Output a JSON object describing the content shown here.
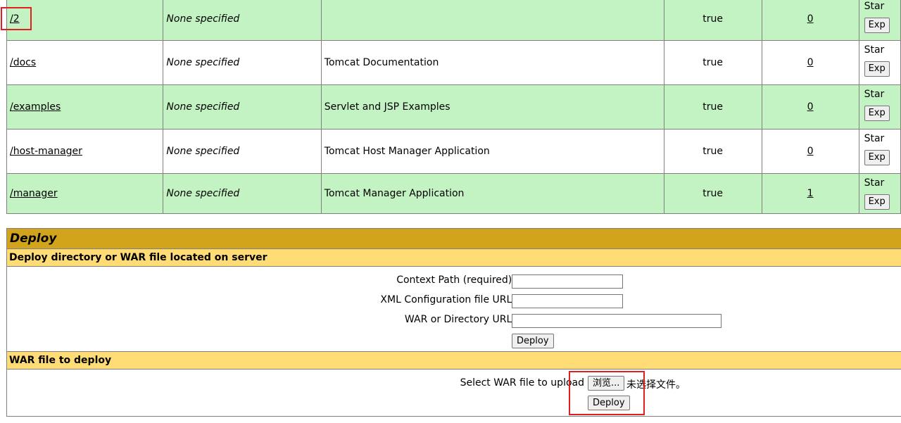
{
  "applications": [
    {
      "path": "/2",
      "version": "None specified",
      "display_name": "",
      "running": "true",
      "sessions": "0",
      "style": "green"
    },
    {
      "path": "/docs",
      "version": "None specified",
      "display_name": "Tomcat Documentation",
      "running": "true",
      "sessions": "0",
      "style": "white"
    },
    {
      "path": "/examples",
      "version": "None specified",
      "display_name": "Servlet and JSP Examples",
      "running": "true",
      "sessions": "0",
      "style": "green"
    },
    {
      "path": "/host-manager",
      "version": "None specified",
      "display_name": "Tomcat Host Manager Application",
      "running": "true",
      "sessions": "0",
      "style": "white"
    },
    {
      "path": "/manager",
      "version": "None specified",
      "display_name": "Tomcat Manager Application",
      "running": "true",
      "sessions": "1",
      "style": "green"
    }
  ],
  "commands": {
    "start": "Star",
    "expire": "Exp"
  },
  "deploy": {
    "title": "Deploy",
    "server_section": {
      "heading": "Deploy directory or WAR file located on server",
      "context_path_label": "Context Path (required):",
      "context_path_value": "",
      "xml_config_label": "XML Configuration file URL:",
      "xml_config_value": "",
      "war_dir_label": "WAR or Directory URL:",
      "war_dir_value": "",
      "deploy_button": "Deploy"
    },
    "war_section": {
      "heading": "WAR file to deploy",
      "select_label": "Select WAR file to upload",
      "browse_button": "浏览...",
      "no_file_text": "未选择文件。",
      "deploy_button": "Deploy"
    }
  },
  "colors": {
    "row_green": "#c3f3c3",
    "title_bar": "#d2a41c",
    "sub_bar": "#ffdc75",
    "highlight": "#e02020"
  }
}
